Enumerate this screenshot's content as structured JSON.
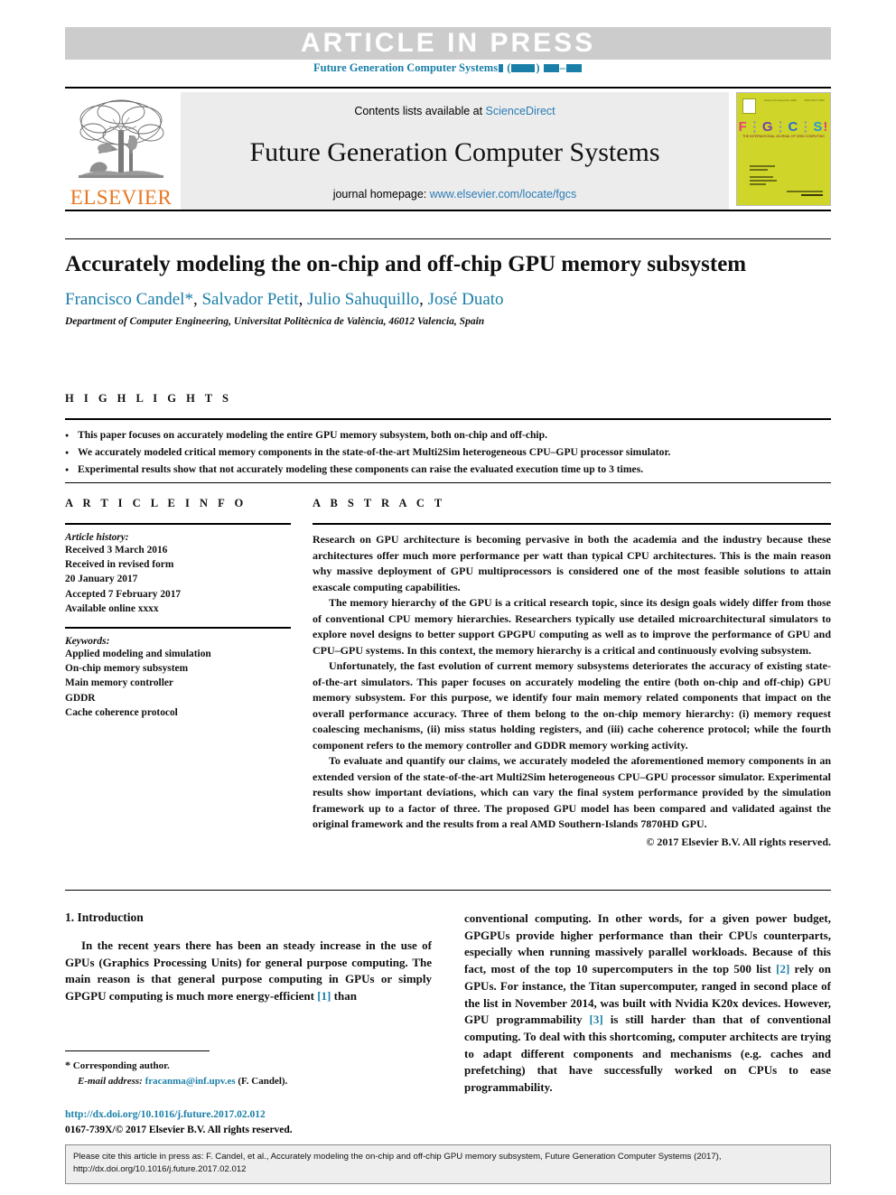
{
  "banner": {
    "article_in_press": "ARTICLE  IN  PRESS",
    "journal_ref_prefix": "Future Generation Computer Systems"
  },
  "masthead": {
    "contents_prefix": "Contents lists available at ",
    "contents_link": "ScienceDirect",
    "journal_title": "Future Generation Computer Systems",
    "homepage_prefix": "journal homepage: ",
    "homepage_link": "www.elsevier.com/locate/fgcs",
    "publisher": "ELSEVIER",
    "cover": {
      "f": "F",
      "g": "G",
      "c": "C",
      "s": "S",
      "bang": "!",
      "subtitle": "THE INTERNATIONAL JOURNAL OF GRID COMPUTING"
    }
  },
  "article": {
    "title": "Accurately modeling the on-chip and off-chip GPU memory subsystem",
    "authors": [
      {
        "name": "Francisco Candel",
        "mark": "*"
      },
      {
        "name": "Salvador Petit",
        "mark": ""
      },
      {
        "name": "Julio Sahuquillo",
        "mark": ""
      },
      {
        "name": "José Duato",
        "mark": ""
      }
    ],
    "affiliation": "Department of Computer Engineering, Universitat Politècnica de València, 46012 Valencia, Spain"
  },
  "highlights": {
    "label": "H I G H L I G H T S",
    "items": [
      "This paper focuses on accurately modeling the entire GPU memory subsystem, both on-chip and off-chip.",
      "We accurately modeled critical memory components in the state-of-the-art Multi2Sim heterogeneous CPU–GPU processor simulator.",
      "Experimental results show that not accurately modeling these components can raise the evaluated execution time up to 3 times."
    ]
  },
  "article_info": {
    "label": "A R T I C L E   I N F O",
    "history_head": "Article history:",
    "history_lines": [
      "Received 3 March 2016",
      "Received in revised form",
      "20 January 2017",
      "Accepted 7 February 2017",
      "Available online xxxx"
    ],
    "keywords_head": "Keywords:",
    "keywords": [
      "Applied modeling and simulation",
      "On-chip memory subsystem",
      "Main memory controller",
      "GDDR",
      "Cache coherence protocol"
    ]
  },
  "abstract": {
    "label": "A B S T R A C T",
    "paragraphs": [
      "Research on GPU architecture is becoming pervasive in both the academia and the industry because these architectures offer much more performance per watt than typical CPU architectures. This is the main reason why massive deployment of GPU multiprocessors is considered one of the most feasible solutions to attain exascale computing capabilities.",
      "The memory hierarchy of the GPU is a critical research topic, since its design goals widely differ from those of conventional CPU memory hierarchies. Researchers typically use detailed microarchitectural simulators to explore novel designs to better support GPGPU computing as well as to improve the performance of GPU and CPU–GPU systems. In this context, the memory hierarchy is a critical and continuously evolving subsystem.",
      "Unfortunately, the fast evolution of current memory subsystems deteriorates the accuracy of existing state-of-the-art simulators. This paper focuses on accurately modeling the entire (both on-chip and off-chip) GPU memory subsystem. For this purpose, we identify four main memory related components that impact on the overall performance accuracy. Three of them belong to the on-chip memory hierarchy: (i) memory request coalescing mechanisms, (ii) miss status holding registers, and (iii) cache coherence protocol; while the fourth component refers to the memory controller and GDDR memory working activity.",
      "To evaluate and quantify our claims, we accurately modeled the aforementioned memory components in an extended version of the state-of-the-art Multi2Sim heterogeneous CPU–GPU processor simulator. Experimental results show important deviations, which can vary the final system performance provided by the simulation framework up to a factor of three. The proposed GPU model has been compared and validated against the original framework and the results from a real AMD Southern-Islands 7870HD GPU."
    ],
    "copyright": "© 2017 Elsevier B.V. All rights reserved."
  },
  "introduction": {
    "heading": "1. Introduction",
    "left_paragraph_pre": "In the recent years there has been an steady increase in the use of GPUs (Graphics Processing Units) for general purpose computing. The main reason is that general purpose computing in GPUs or simply GPGPU computing is much more energy-efficient ",
    "left_cite": "[1]",
    "left_paragraph_post": " than",
    "right_part1": "conventional computing. In other words, for a given power budget, GPGPUs provide higher performance than their CPUs counterparts, especially when running massively parallel workloads. Because of this fact, most of the top 10 supercomputers in the top 500 list ",
    "right_cite1": "[2]",
    "right_part2": " rely on GPUs. For instance, the Titan supercomputer, ranged in second place of the list in November 2014, was built with Nvidia K20x devices. However, GPU programmability ",
    "right_cite2": "[3]",
    "right_part3": " is still harder than that of conventional computing. To deal with this shortcoming, computer architects are trying to adapt different components and mechanisms (e.g. caches and prefetching) that have successfully worked on CPUs to ease programmability."
  },
  "footer": {
    "corresponding_star": "*",
    "corresponding_text": "Corresponding author.",
    "email_label": "E-mail address:",
    "email": "fracanma@inf.upv.es",
    "email_suffix": "(F. Candel).",
    "doi": "http://dx.doi.org/10.1016/j.future.2017.02.012",
    "issn_line": "0167-739X/© 2017 Elsevier B.V. All rights reserved."
  },
  "citation_box": {
    "line1": "Please cite this article in press as: F. Candel, et al., Accurately modeling the on-chip and off-chip GPU memory subsystem, Future Generation Computer Systems (2017),",
    "line2": "http://dx.doi.org/10.1016/j.future.2017.02.012"
  },
  "colors": {
    "link_blue": "#1a7fa8",
    "banner_gray": "#cccccc",
    "elsevier_orange": "#e87722",
    "cover_green": "#cfd629"
  }
}
